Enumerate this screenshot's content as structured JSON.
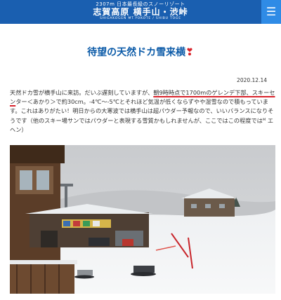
{
  "header": {
    "tagline": "2307m 日本最長級のスノーリゾート",
    "site_name": "志賀高原 横手山・渋峠",
    "site_sub": "SHIGAKOGEN  MT.YOKOTE / SHIBU TOGE",
    "menu_icon": "menu-icon",
    "menu_glyph": "☰"
  },
  "article": {
    "title": "待望の天然ドカ雪来横",
    "title_icon": "heart-icon",
    "title_icon_glyph": "❣",
    "date": "2020.12.14",
    "paragraph": {
      "part1": "天然ドカ雪が横手山に来訪。だいぶ遅刻していますが、",
      "highlight": "朝9時時点で1700mのゲレンデ下部、スキーセン",
      "part2": "ター＜あかり＞で約30cm。-4℃～-5℃とそれほど気温が低くならずやや湿雪なので積もっています。これはありがたい！明日からの大寒波では横手山は超パウダー予報なので、いいバランスになりそうです（他のスキー場サンではパウダーと表現する雪質かもしれませんが、ここではこの程度ではᴹ エヘン）"
    }
  },
  "photo": {
    "description": "snowy ski resort scene"
  },
  "colors": {
    "header_bg": "#1a5fb0",
    "menu_bg": "#2f8be6",
    "title": "#0c5ba8",
    "accent_red": "#d8222a"
  }
}
